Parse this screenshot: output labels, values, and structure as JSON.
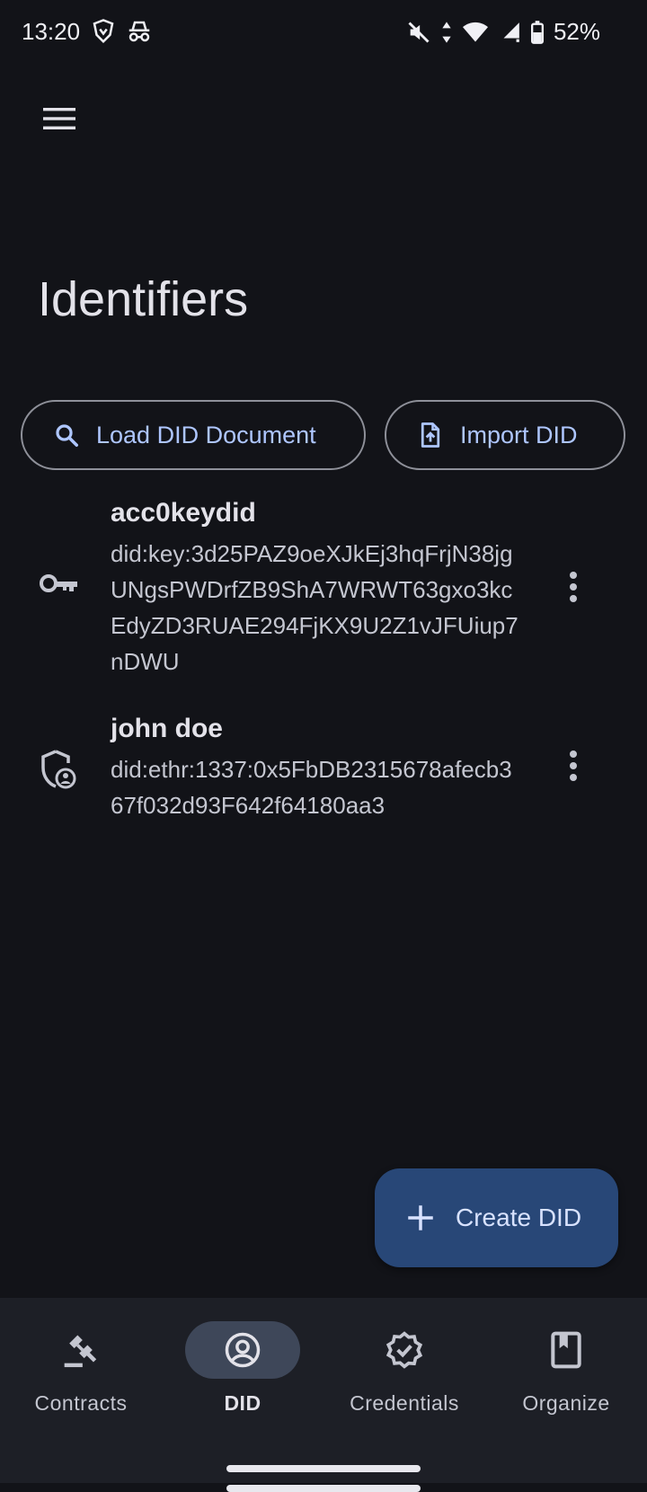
{
  "status_bar": {
    "time": "13:20",
    "battery": "52%",
    "icons": [
      "brave-icon",
      "incognito-icon",
      "mute-icon",
      "data-arrows-icon",
      "wifi-icon",
      "signal-icon",
      "battery-icon"
    ]
  },
  "header": {
    "title": "Identifiers",
    "menu_icon": "menu-icon"
  },
  "actions": {
    "load_label": "Load DID Document",
    "load_icon": "search-icon",
    "import_label": "Import DID",
    "import_icon": "file-upload-icon"
  },
  "identifiers": [
    {
      "name": "acc0keydid",
      "did": "did:key:3d25PAZ9oeXJkEj3hqFrjN38jgUNgsPWDrfZB9ShA7WRWT63gxo3kcEdyZD3RUAE294FjKX9U2Z1vJFUiup7nDWU",
      "icon": "key-icon"
    },
    {
      "name": "john doe",
      "did": "did:ethr:1337:0x5FbDB2315678afecb367f032d93F642f64180aa3",
      "icon": "shield-person-icon"
    }
  ],
  "fab": {
    "label": "Create DID",
    "icon": "plus-icon"
  },
  "bottom_nav": {
    "items": [
      {
        "label": "Contracts",
        "icon": "gavel-icon",
        "active": false
      },
      {
        "label": "DID",
        "icon": "account-circle-icon",
        "active": true
      },
      {
        "label": "Credentials",
        "icon": "verified-icon",
        "active": false
      },
      {
        "label": "Organize",
        "icon": "bookmark-book-icon",
        "active": false
      }
    ]
  },
  "colors": {
    "background": "#121318",
    "accent": "#aec6ff",
    "fab": "#284777",
    "nav_background": "#1d1f26",
    "active_pill": "#3e4759"
  }
}
